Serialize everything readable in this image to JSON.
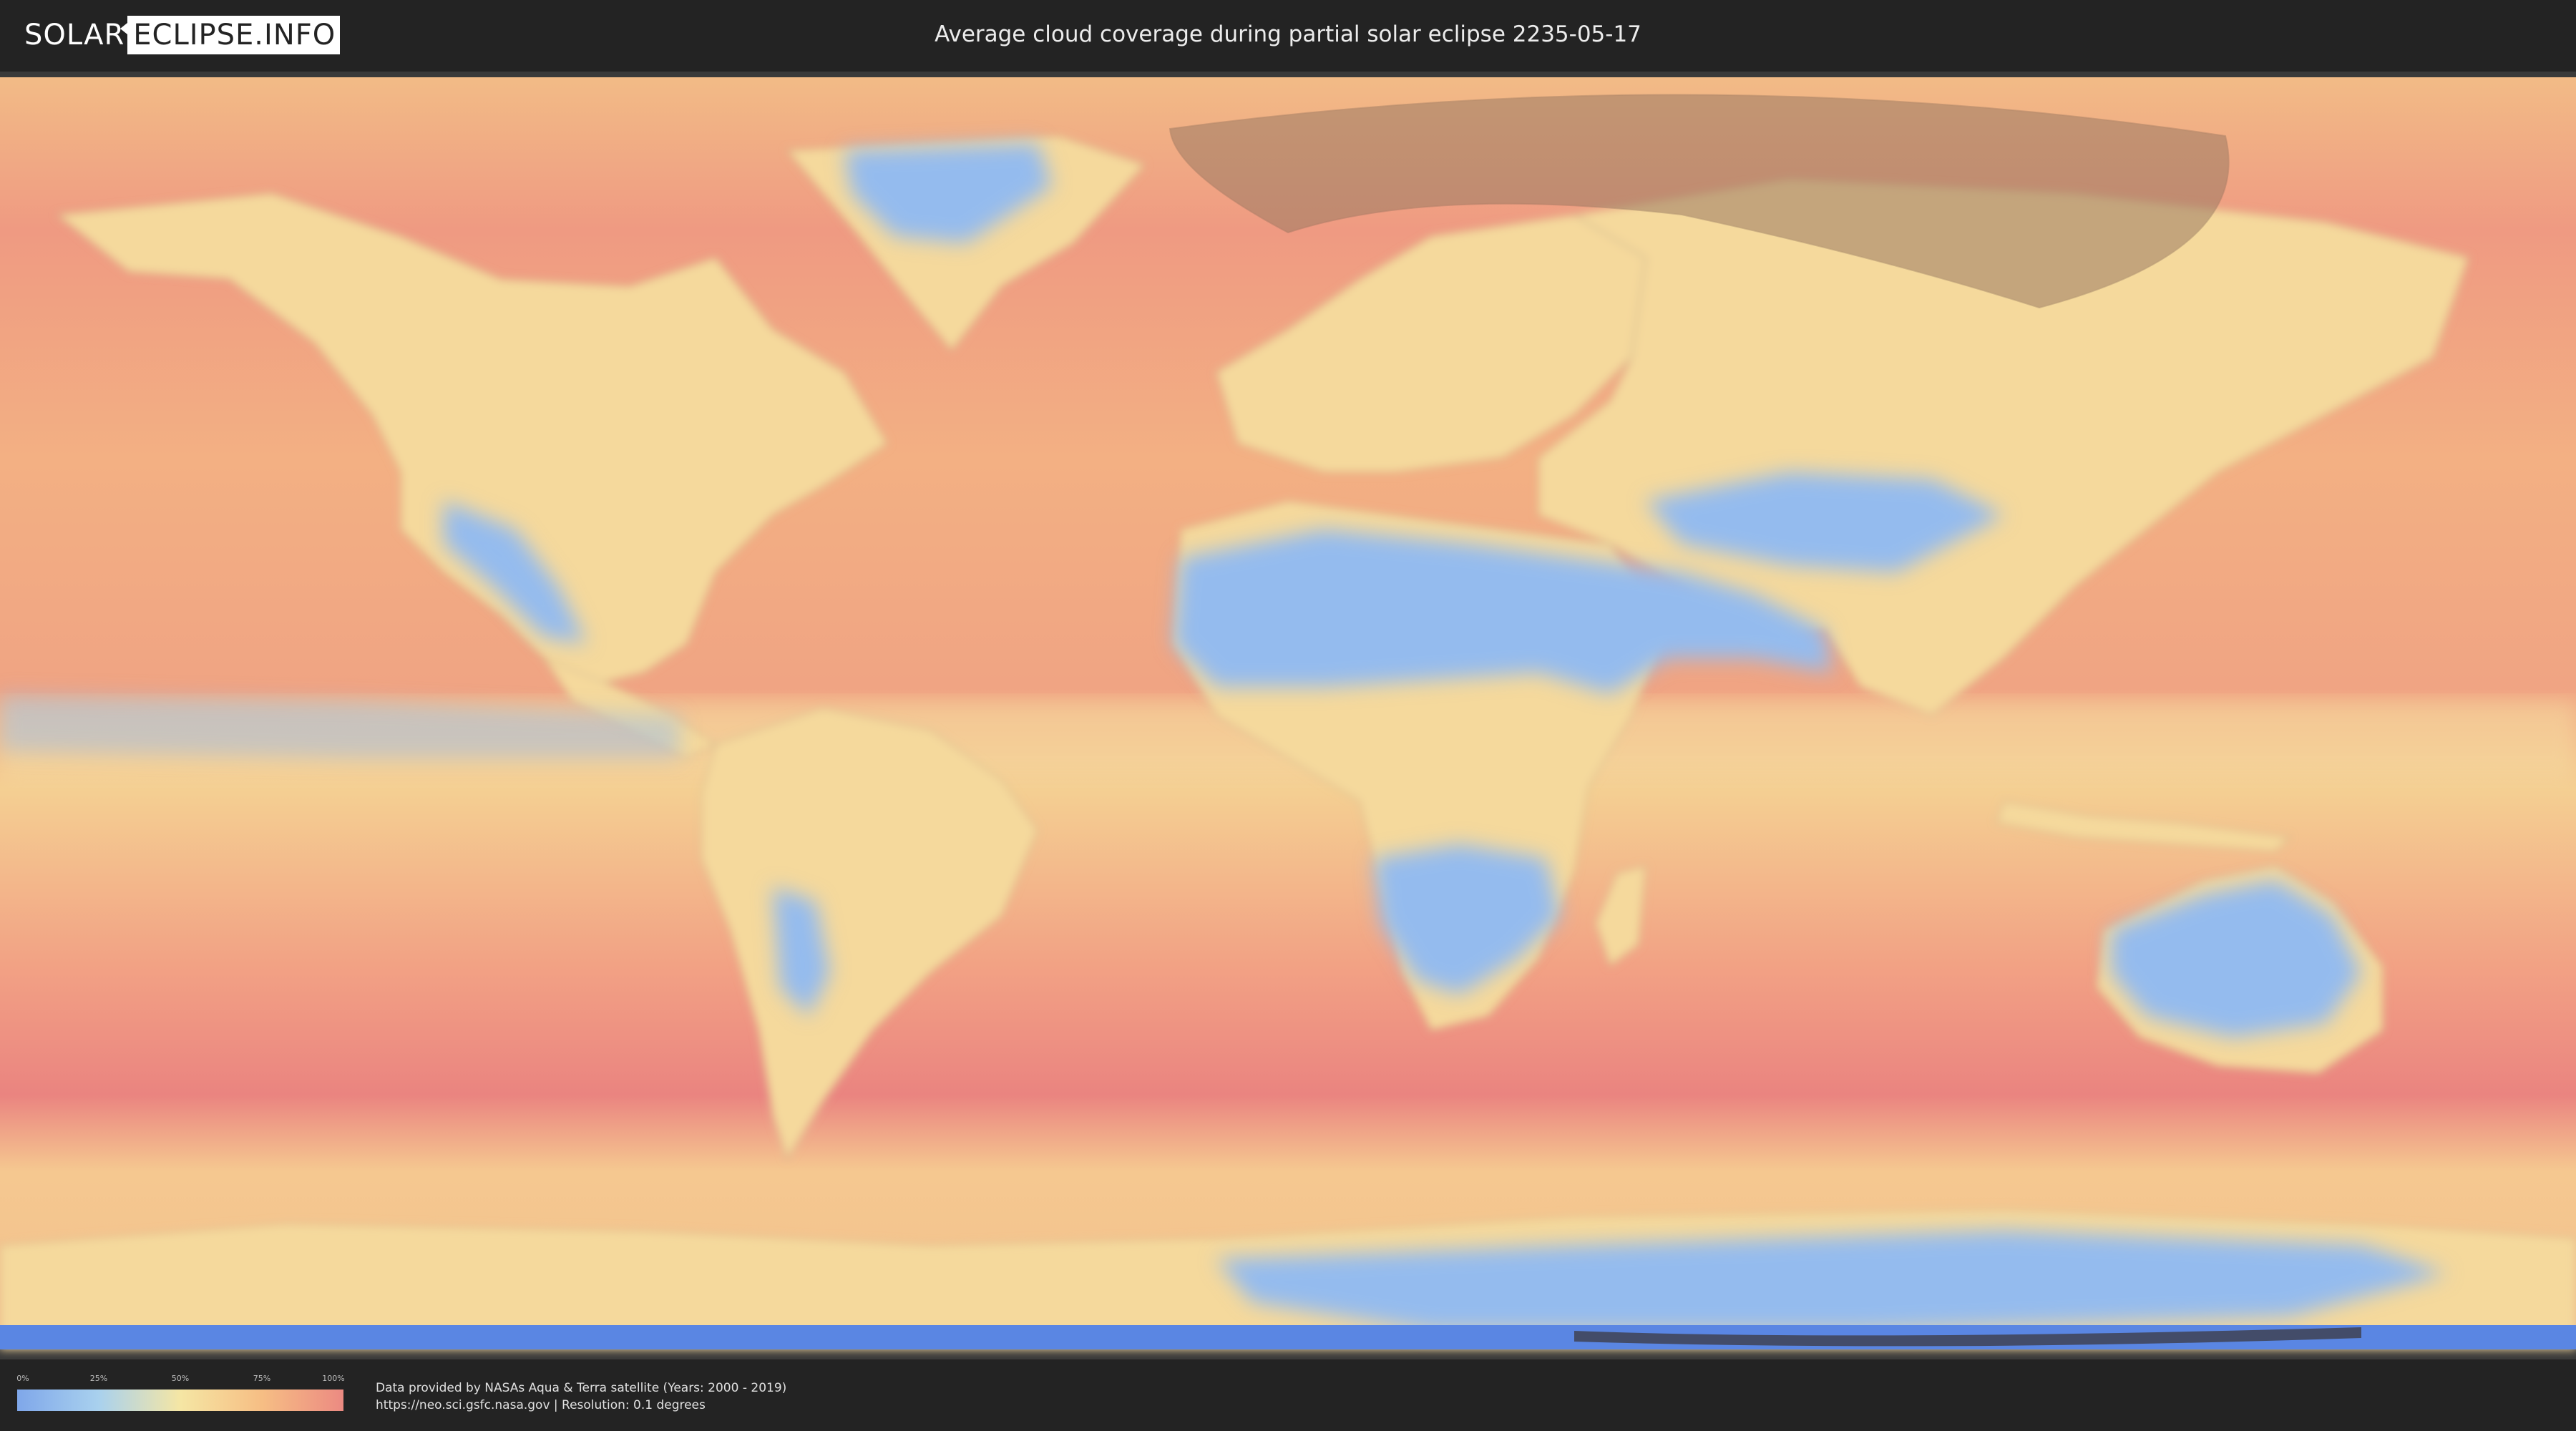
{
  "header": {
    "logo_left": "SOLAR",
    "logo_right": "ECLIPSE.INFO",
    "title": "Average cloud coverage during partial solar eclipse 2235-05-17"
  },
  "legend": {
    "ticks": [
      "0%",
      "25%",
      "50%",
      "75%",
      "100%"
    ],
    "colors": [
      "#7fa7ea",
      "#a9d1ee",
      "#f5e6a4",
      "#f6be84",
      "#ec8a82"
    ]
  },
  "footer": {
    "credit_line1": "Data provided by NASAs Aqua & Terra satellite (Years: 2000 - 2019)",
    "credit_line2": "https://neo.sci.gsfc.nasa.gov | Resolution: 0.1 degrees"
  },
  "map": {
    "ocean_color": "#ef9a82",
    "land_cloudy_color": "#f5d79a",
    "land_clear_color": "#94bbee",
    "eclipse_shadow_color": "#9b7b63",
    "antarctic_ice_color": "#5a86e3"
  }
}
